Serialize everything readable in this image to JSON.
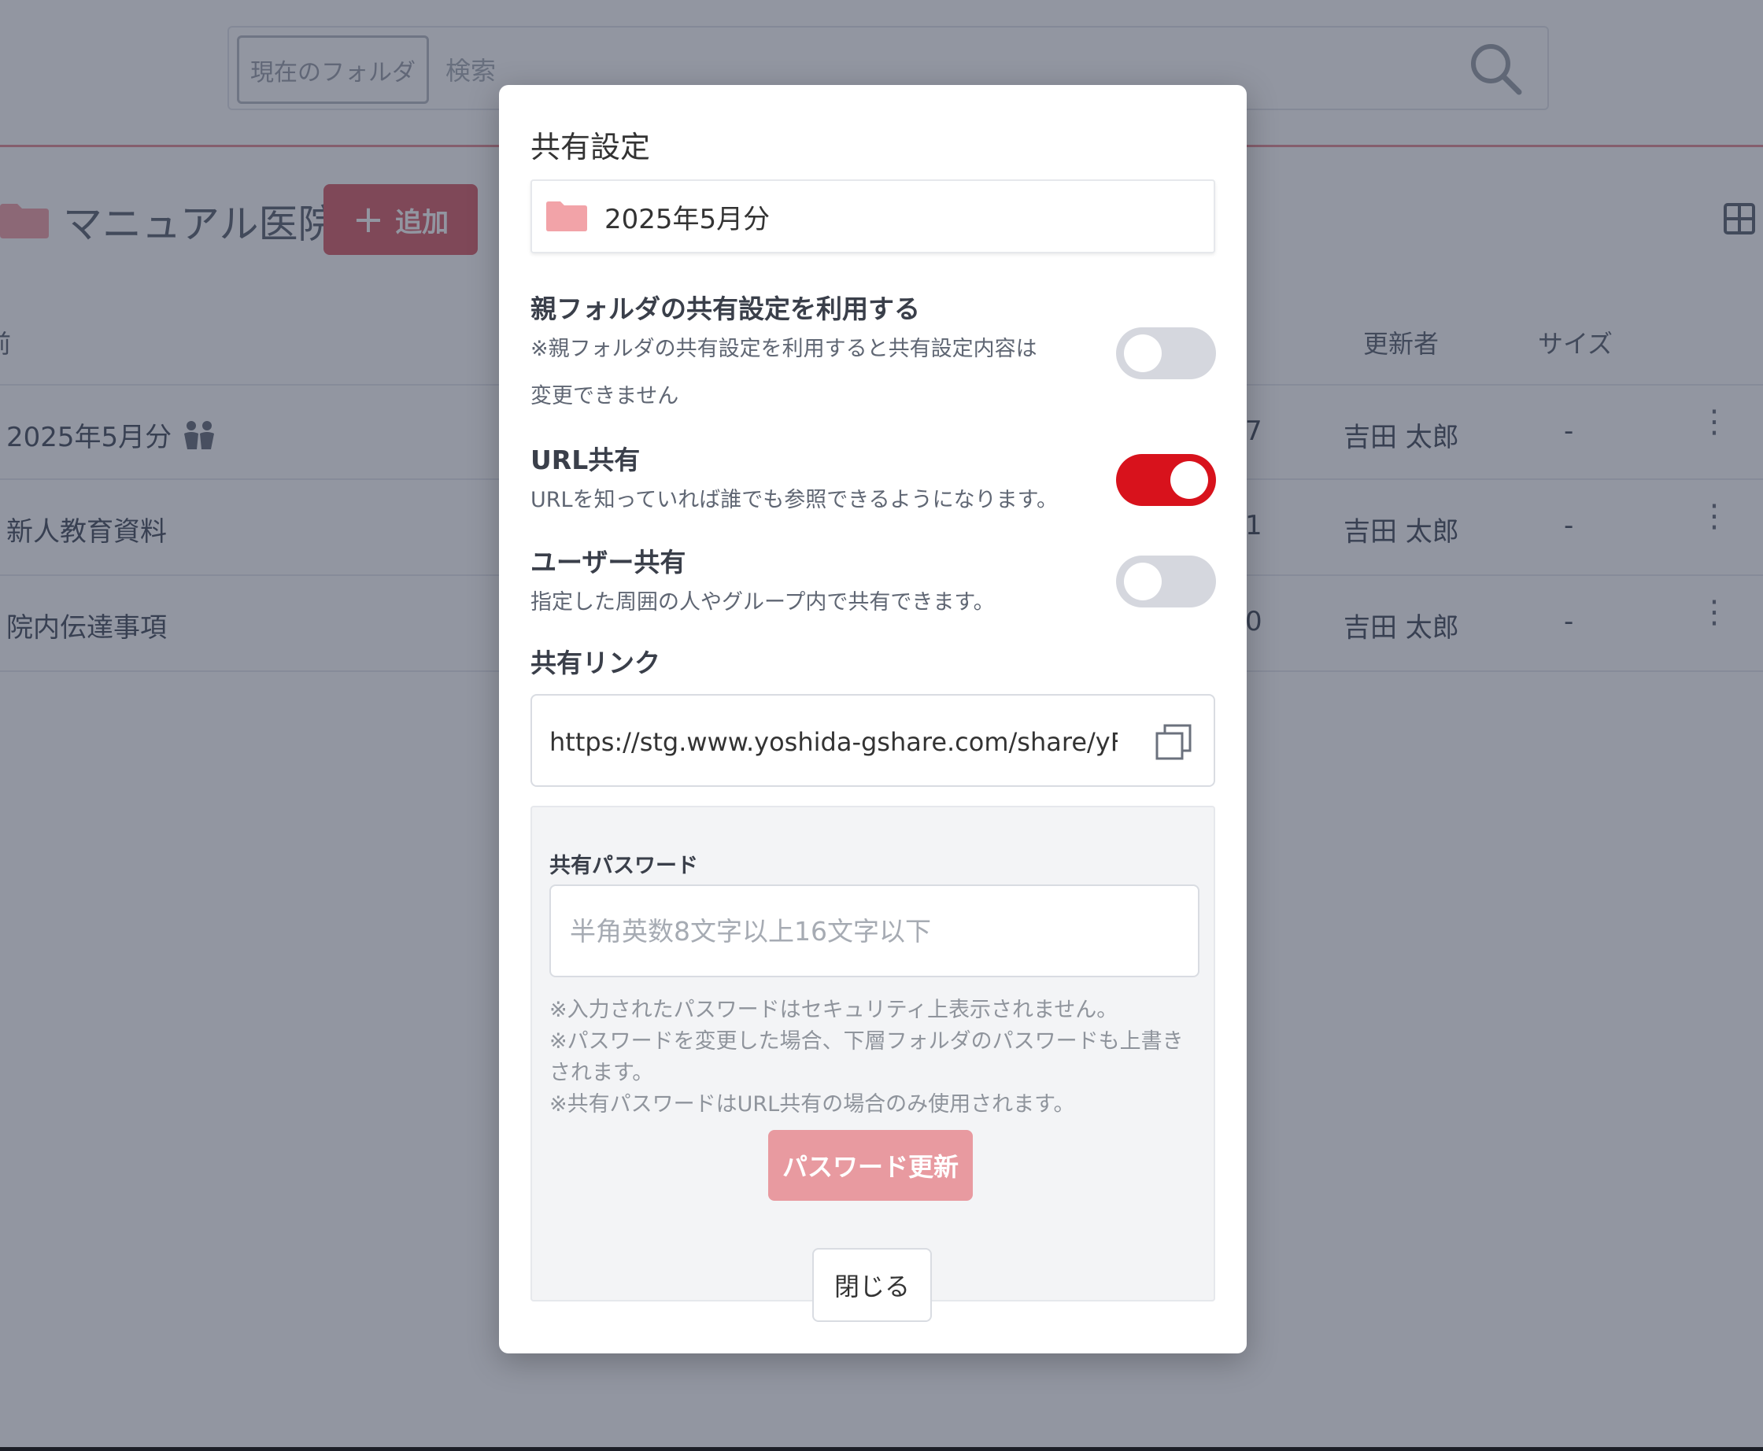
{
  "background": {
    "search": {
      "scope_label": "現在のフォルダ",
      "placeholder": "検索"
    },
    "folder_title": "マニュアル医院",
    "add_button_label": "追加",
    "columns": {
      "name_partial": "前",
      "updated_by": "更新者",
      "size": "サイズ"
    },
    "rows": [
      {
        "name": "2025年5月分",
        "num_partial": "7",
        "user": "吉田 太郎",
        "size": "-",
        "shared": true
      },
      {
        "name": "新人教育資料",
        "num_partial": "1",
        "user": "吉田 太郎",
        "size": "-",
        "shared": false
      },
      {
        "name": "院内伝達事項",
        "num_partial": "0",
        "user": "吉田 太郎",
        "size": "-",
        "shared": false
      }
    ]
  },
  "modal": {
    "title": "共有設定",
    "folder_name": "2025年5月分",
    "parent_setting": {
      "title": "親フォルダの共有設定を利用する",
      "desc_line1": "※親フォルダの共有設定を利用すると共有設定内容は",
      "desc_line2": "変更できません",
      "enabled": false
    },
    "url_share": {
      "title": "URL共有",
      "desc": "URLを知っていれば誰でも参照できるようになります。",
      "enabled": true
    },
    "user_share": {
      "title": "ユーザー共有",
      "desc": "指定した周囲の人やグループ内で共有できます。",
      "enabled": false
    },
    "share_link": {
      "label": "共有リンク",
      "url": "https://stg.www.yoshida-gshare.com/share/yFH"
    },
    "password": {
      "label": "共有パスワード",
      "placeholder": "半角英数8文字以上16文字以下",
      "note1": "※入力されたパスワードはセキュリティ上表示されません。",
      "note2": "※パスワードを変更した場合、下層フォルダのパスワードも上書きされます。",
      "note3": "※共有パスワードはURL共有の場合のみ使用されます。",
      "update_button": "パスワード更新"
    },
    "close_button": "閉じる"
  },
  "colors": {
    "accent": "#d8121c",
    "brand_pink": "#d9636d",
    "folder_pink": "#f2a3a8",
    "overlay": "#252d43"
  },
  "icons": {
    "search": "search-icon",
    "folder": "folder-icon",
    "grid": "grid-view-icon",
    "people": "people-icon",
    "copy": "copy-icon",
    "kebab": "kebab-menu-icon"
  }
}
